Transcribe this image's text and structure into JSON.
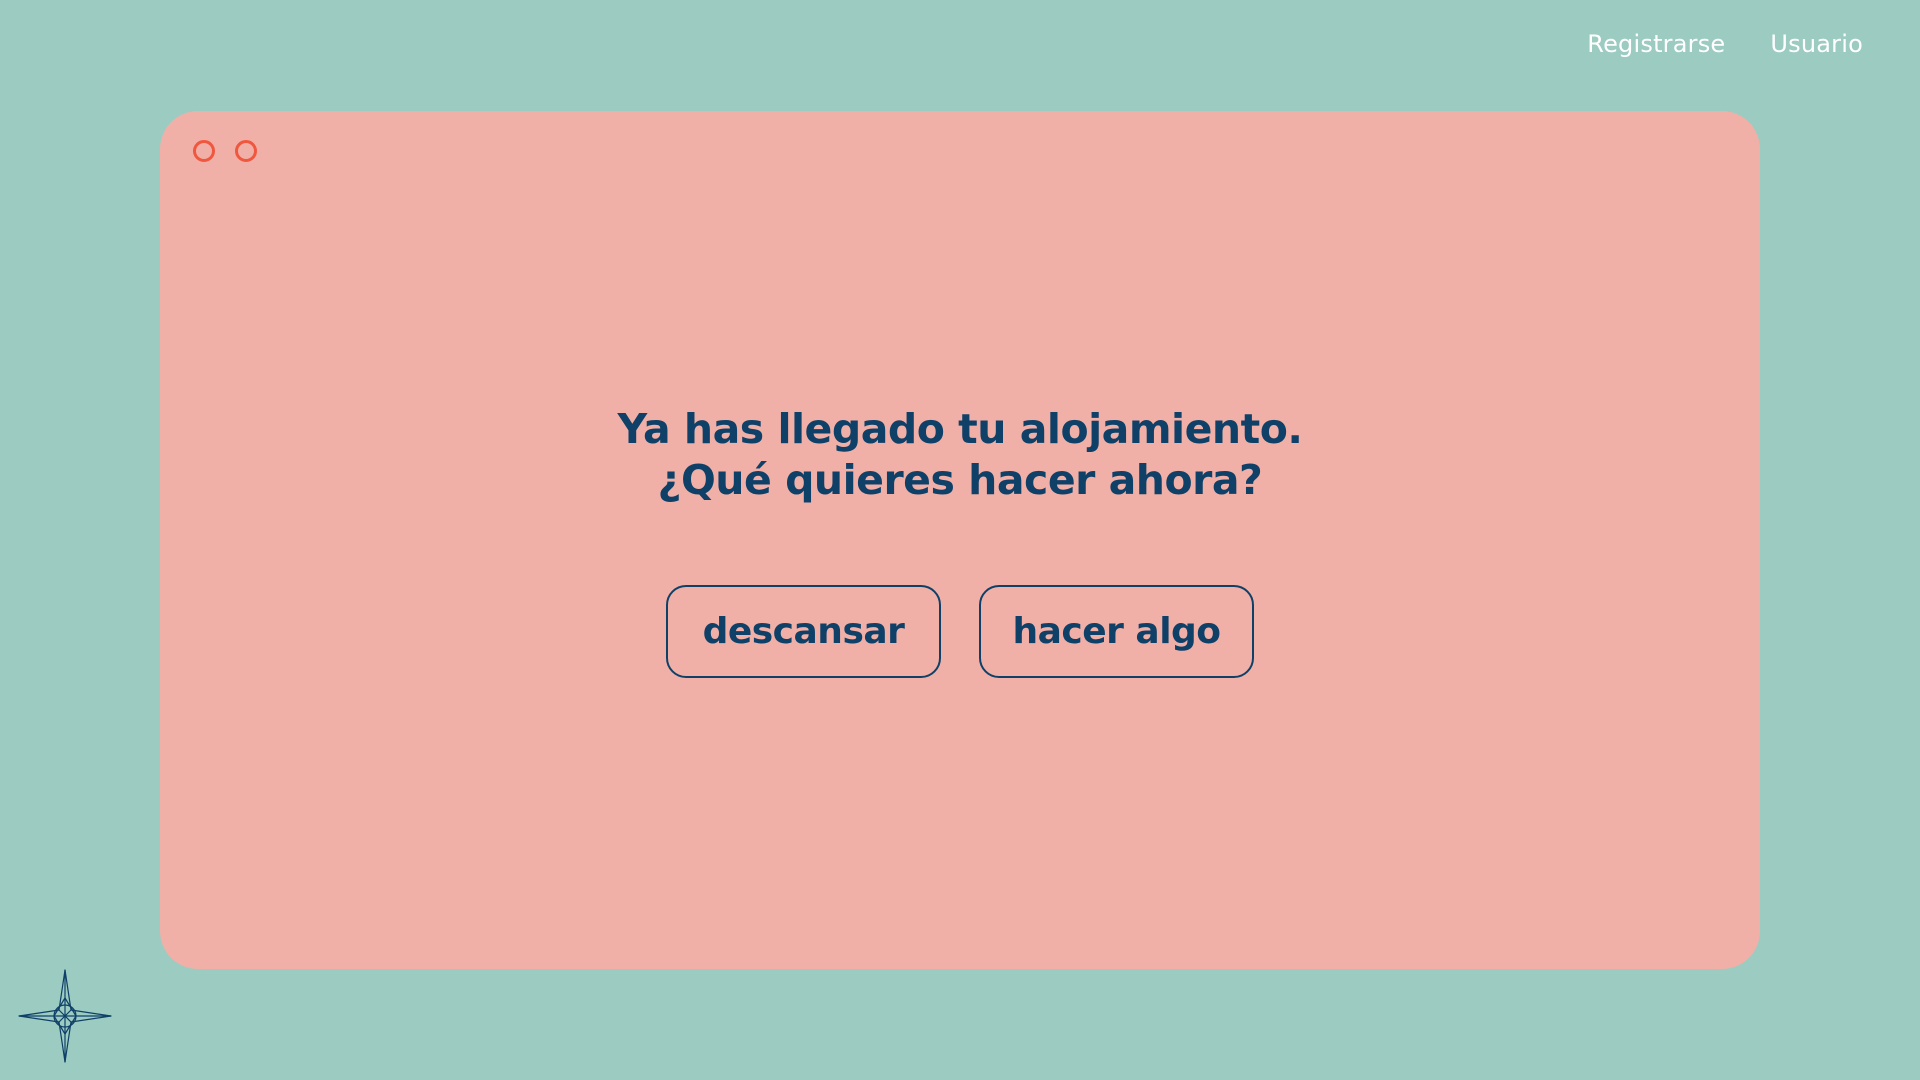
{
  "nav": {
    "register_label": "Registrarse",
    "user_label": "Usuario"
  },
  "dialog": {
    "window_dots": [
      "window-dot",
      "window-dot"
    ],
    "question_line1": "Ya has llegado tu alojamiento.",
    "question_line2": "¿Qué quieres hacer ahora?",
    "buttons": {
      "rest_label": "descansar",
      "do_something_label": "hacer algo"
    }
  },
  "decor": {
    "corner_icon": "compass-star-icon"
  },
  "colors": {
    "background": "#9ccbc1",
    "card": "#f1b0a7",
    "accent_dots": "#f0573f",
    "text_primary": "#0f4068",
    "nav_text": "#ffffff"
  }
}
